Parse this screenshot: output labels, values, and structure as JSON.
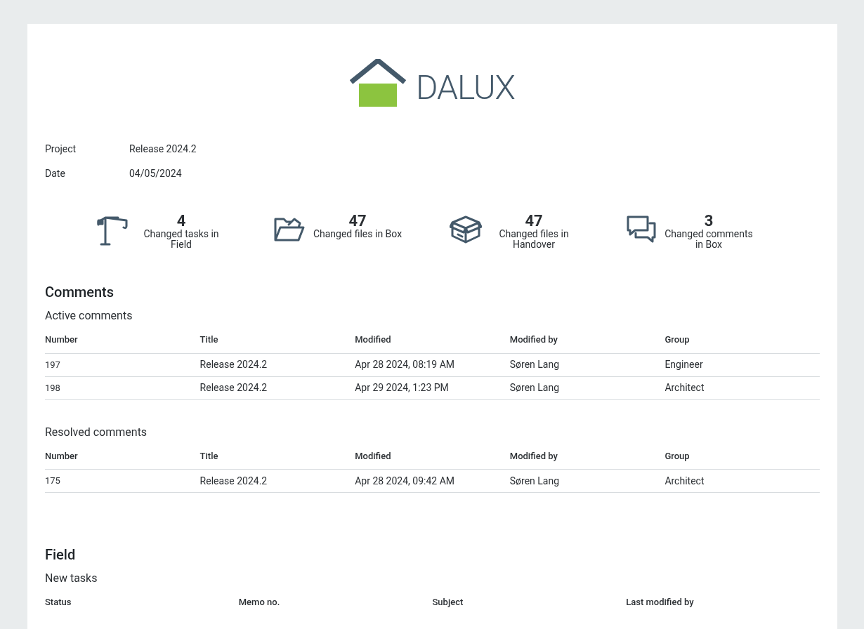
{
  "logo": {
    "text": "DALUX"
  },
  "info": [
    {
      "label": "Project",
      "value": "Release 2024.2"
    },
    {
      "label": "Date",
      "value": "04/05/2024"
    }
  ],
  "stats": [
    {
      "kind": "crane",
      "count": "4",
      "label": "Changed tasks in Field"
    },
    {
      "kind": "folder",
      "count": "47",
      "label": "Changed files in Box"
    },
    {
      "kind": "box",
      "count": "47",
      "label": "Changed files in Handover"
    },
    {
      "kind": "comments",
      "count": "3",
      "label": "Changed comments in Box"
    }
  ],
  "sections": [
    {
      "title": "Comments",
      "tables": [
        {
          "title": "Active comments",
          "columns": [
            "Number",
            "Title",
            "Modified",
            "Modified by",
            "Group"
          ],
          "rows": [
            [
              "197",
              "Release 2024.2",
              "Apr 28 2024, 08:19 AM",
              "Søren Lang",
              "Engineer"
            ],
            [
              "198",
              "Release 2024.2",
              "Apr 29 2024, 1:23 PM",
              "Søren Lang",
              "Architect"
            ]
          ]
        },
        {
          "title": "Resolved comments",
          "columns": [
            "Number",
            "Title",
            "Modified",
            "Modified by",
            "Group"
          ],
          "rows": [
            [
              "175",
              "Release 2024.2",
              "Apr 28 2024, 09:42 AM",
              "Søren Lang",
              "Architect"
            ]
          ]
        }
      ]
    },
    {
      "title": "Field",
      "tables": [
        {
          "title": "New tasks",
          "columns": [
            "Status",
            "Memo no.",
            "Subject",
            "Last modified by"
          ]
        }
      ]
    }
  ]
}
